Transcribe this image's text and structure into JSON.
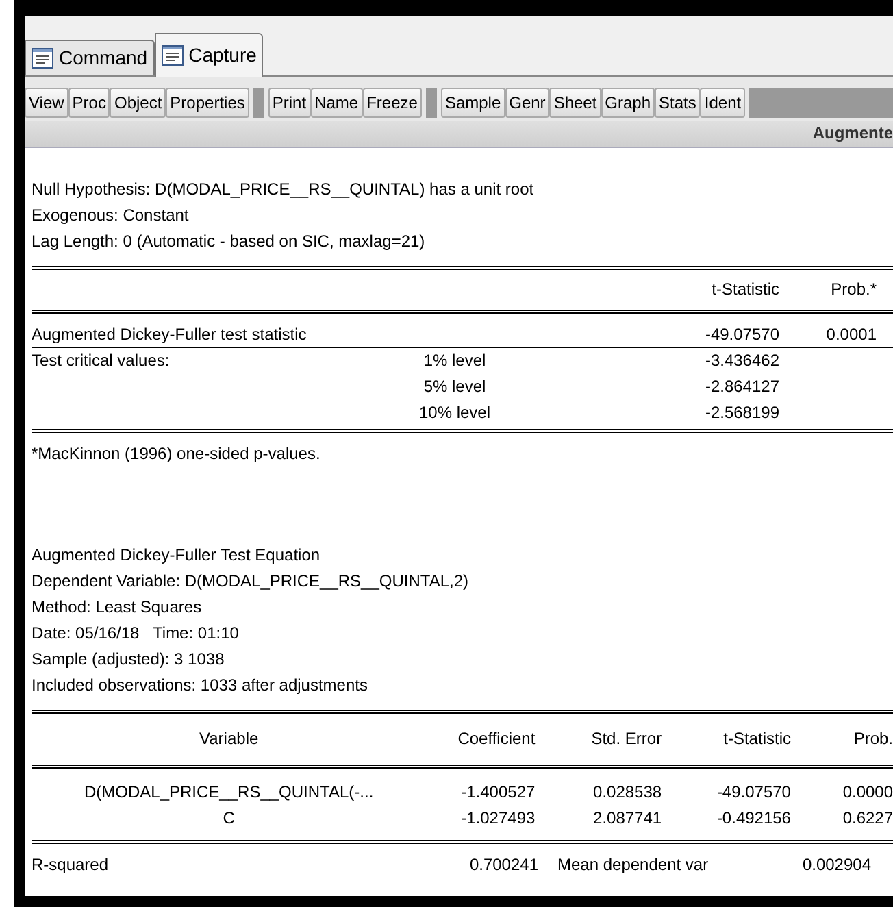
{
  "tabs": [
    {
      "label": "Command",
      "selected": false
    },
    {
      "label": "Capture",
      "selected": true
    }
  ],
  "toolbar": [
    [
      "View",
      "Proc",
      "Object",
      "Properties"
    ],
    [
      "Print",
      "Name",
      "Freeze"
    ],
    [
      "Sample",
      "Genr",
      "Sheet",
      "Graph",
      "Stats",
      "Ident"
    ]
  ],
  "output_title": "Augmente",
  "header_lines": [
    "Null Hypothesis: D(MODAL_PRICE__RS__QUINTAL) has a unit root",
    "Exogenous: Constant",
    "Lag Length: 0 (Automatic - based on SIC, maxlag=21)"
  ],
  "test_table": {
    "columns": [
      "t-Statistic",
      "Prob.*"
    ],
    "rows": [
      {
        "label": "Augmented Dickey-Fuller test statistic",
        "level": "",
        "t_statistic": "-49.07570",
        "prob": "0.0001"
      },
      {
        "label": "Test critical values:",
        "level": "1% level",
        "t_statistic": "-3.436462",
        "prob": ""
      },
      {
        "label": "",
        "level": "5% level",
        "t_statistic": "-2.864127",
        "prob": ""
      },
      {
        "label": "",
        "level": "10% level",
        "t_statistic": "-2.568199",
        "prob": ""
      }
    ]
  },
  "footnote": "*MacKinnon (1996) one-sided p-values.",
  "equation_lines": [
    "Augmented Dickey-Fuller Test Equation",
    "Dependent Variable: D(MODAL_PRICE__RS__QUINTAL,2)",
    "Method: Least Squares",
    "Date: 05/16/18   Time: 01:10",
    "Sample (adjusted): 3 1038",
    "Included observations: 1033 after adjustments"
  ],
  "coef_table": {
    "columns": [
      "Variable",
      "Coefficient",
      "Std. Error",
      "t-Statistic",
      "Prob."
    ],
    "rows": [
      [
        "D(MODAL_PRICE__RS__QUINTAL(-...",
        "-1.400527",
        "0.028538",
        "-49.07570",
        "0.0000"
      ],
      [
        "C",
        "-1.027493",
        "2.087741",
        "-0.492156",
        "0.6227"
      ]
    ]
  },
  "stats_rows": [
    {
      "label": "R-squared",
      "value": "0.700241",
      "label_2": "Mean dependent var",
      "value_2": "0.002904"
    }
  ]
}
